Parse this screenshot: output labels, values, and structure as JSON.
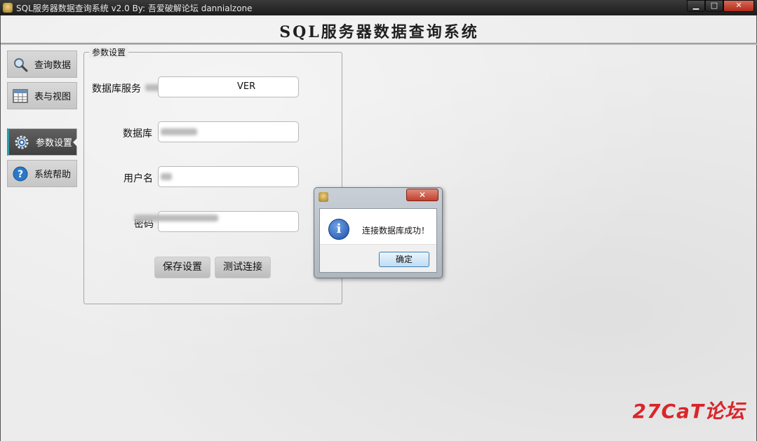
{
  "window": {
    "title": "SQL服务器数据查询系统 v2.0  By: 吾爱破解论坛 dannialzone",
    "minimize": "▁",
    "maximize": "□",
    "close": "✕"
  },
  "app": {
    "heading": "SQL服务器数据查询系统"
  },
  "sidebar": {
    "items": [
      {
        "label": "查询数据",
        "icon": "magnifier-icon"
      },
      {
        "label": "表与视图",
        "icon": "table-icon"
      },
      {
        "label": "参数设置",
        "icon": "gear-icon",
        "active": true
      },
      {
        "label": "系统帮助",
        "icon": "help-icon"
      }
    ]
  },
  "settings": {
    "group_title": "参数设置",
    "fields": [
      {
        "label": "数据库服务",
        "value": "VER"
      },
      {
        "label": "数据库",
        "value": ""
      },
      {
        "label": "用户名",
        "value": ""
      },
      {
        "label": "密码",
        "value": ""
      }
    ],
    "save_label": "保存设置",
    "test_label": "测试连接"
  },
  "dialog": {
    "close": "✕",
    "message": "连接数据库成功！",
    "icon": "info-icon",
    "icon_glyph": "i",
    "ok_label": "确定"
  },
  "watermark": {
    "text": "27CaT论坛",
    "color": "#d9262b"
  }
}
